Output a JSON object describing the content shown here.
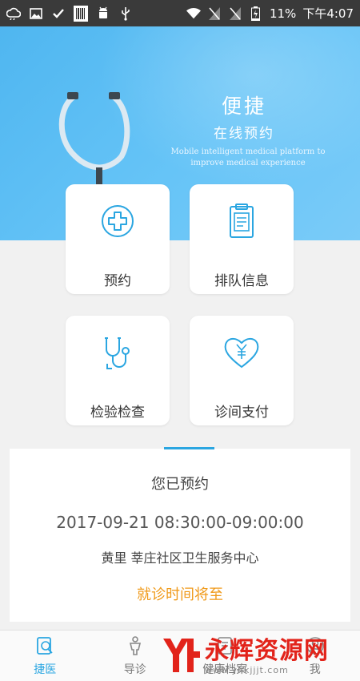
{
  "status_bar": {
    "battery_percent": "11%",
    "time": "下午4:07",
    "left_icons": [
      "cloud-icon",
      "image-icon",
      "check-icon",
      "barcode-icon",
      "android-icon",
      "usb-icon"
    ],
    "right_icons": [
      "wifi-icon",
      "no-signal-icon",
      "no-signal-icon",
      "battery-icon"
    ]
  },
  "banner": {
    "title": "便捷",
    "subtitle": "在线预约",
    "english_line1": "Mobile intelligent medical platform to",
    "english_line2": "improve medical experience",
    "colors": {
      "top": "#4fb6f0",
      "bottom": "#7acbf8"
    }
  },
  "cards": [
    {
      "label": "预约",
      "icon": "medical-cross-icon"
    },
    {
      "label": "排队信息",
      "icon": "clipboard-icon"
    },
    {
      "label": "检验检查",
      "icon": "stethoscope-icon"
    },
    {
      "label": "诊间支付",
      "icon": "heart-yuan-icon"
    }
  ],
  "appointment": {
    "title": "您已预约",
    "time": "2017-09-21 08:30:00-09:00:00",
    "place": "黄里 莘庄社区卫生服务中心",
    "status": "就诊时间将至",
    "status_color": "#f09a1a"
  },
  "bottom_nav": {
    "items": [
      {
        "label": "捷医",
        "icon": "doctor-card-icon",
        "active": true
      },
      {
        "label": "导诊",
        "icon": "guide-person-icon",
        "active": false
      },
      {
        "label": "健康档案",
        "icon": "health-record-icon",
        "active": false
      },
      {
        "label": "我",
        "icon": "profile-icon",
        "active": false
      }
    ],
    "active_color": "#2ba6e1"
  },
  "watermark": {
    "brand": "永辉资源网",
    "url": "www.yhkjjjt.com"
  }
}
